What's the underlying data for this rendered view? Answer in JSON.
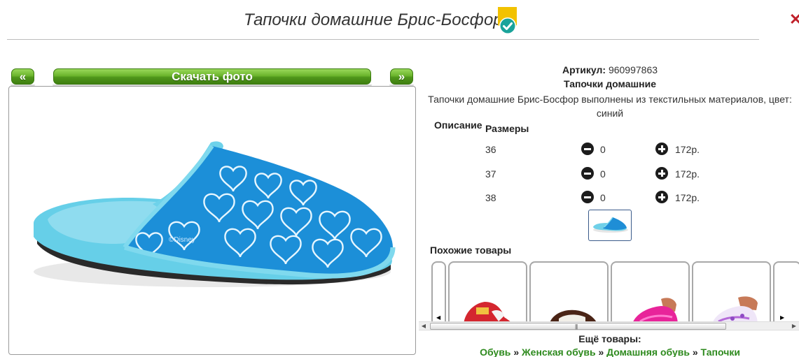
{
  "header": {
    "title": "Тапочки домашние Брис-Босфор",
    "verified_icon": "verified-badge-icon",
    "close_icon": "close-icon",
    "accent_color": "#c0202a"
  },
  "photo_nav": {
    "prev_label": "«",
    "download_label": "Скачать фото",
    "next_label": "»",
    "button_color": "#5ea324"
  },
  "product": {
    "article_label": "Артикул:",
    "article_value": "960997863",
    "subtitle": "Тапочки домашние",
    "description": "Тапочки домашние Брис-Босфор выполнены из текстильных материалов, цвет: синий",
    "description_tab": "Описание",
    "sizes_tab": "Размеры",
    "image_watermark": "©Disney"
  },
  "sizes": [
    {
      "size": "36",
      "qty": "0",
      "price": "172р."
    },
    {
      "size": "37",
      "qty": "0",
      "price": "172р."
    },
    {
      "size": "38",
      "qty": "0",
      "price": "172р."
    }
  ],
  "similar": {
    "heading": "Похожие товары",
    "items": [
      {
        "name": "similar-item-1"
      },
      {
        "name": "similar-item-2"
      },
      {
        "name": "similar-item-3"
      },
      {
        "name": "similar-item-4"
      }
    ]
  },
  "more": {
    "heading": "Ещё товары:",
    "breadcrumbs": [
      "Обувь",
      "Женская обувь",
      "Домашняя обувь",
      "Тапочки"
    ],
    "separator": "»",
    "link_color": "#2e8a1e"
  }
}
